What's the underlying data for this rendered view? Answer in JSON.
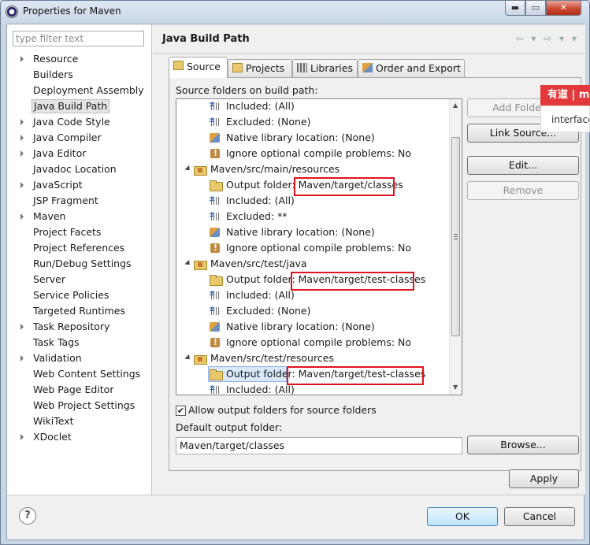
{
  "window": {
    "title": "Properties for Maven",
    "controls": {
      "minimize": "▬",
      "maximize": "▭",
      "close": "✕"
    }
  },
  "sidebar": {
    "filter_placeholder": "type filter text",
    "items": [
      {
        "label": "Resource",
        "expandable": true
      },
      {
        "label": "Builders",
        "expandable": false
      },
      {
        "label": "Deployment Assembly",
        "expandable": false
      },
      {
        "label": "Java Build Path",
        "expandable": false,
        "selected": true
      },
      {
        "label": "Java Code Style",
        "expandable": true
      },
      {
        "label": "Java Compiler",
        "expandable": true
      },
      {
        "label": "Java Editor",
        "expandable": true
      },
      {
        "label": "Javadoc Location",
        "expandable": false
      },
      {
        "label": "JavaScript",
        "expandable": true
      },
      {
        "label": "JSP Fragment",
        "expandable": false
      },
      {
        "label": "Maven",
        "expandable": true
      },
      {
        "label": "Project Facets",
        "expandable": false
      },
      {
        "label": "Project References",
        "expandable": false
      },
      {
        "label": "Run/Debug Settings",
        "expandable": false
      },
      {
        "label": "Server",
        "expandable": false
      },
      {
        "label": "Service Policies",
        "expandable": false
      },
      {
        "label": "Targeted Runtimes",
        "expandable": false
      },
      {
        "label": "Task Repository",
        "expandable": true
      },
      {
        "label": "Task Tags",
        "expandable": false
      },
      {
        "label": "Validation",
        "expandable": true
      },
      {
        "label": "Web Content Settings",
        "expandable": false
      },
      {
        "label": "Web Page Editor",
        "expandable": false
      },
      {
        "label": "Web Project Settings",
        "expandable": false
      },
      {
        "label": "WikiText",
        "expandable": false
      },
      {
        "label": "XDoclet",
        "expandable": true
      }
    ]
  },
  "page": {
    "title": "Java Build Path",
    "nav_icons": "⇦ ▾ ⇨ ▾ ▾",
    "tabs": [
      {
        "label": "Source",
        "active": true
      },
      {
        "label": "Projects",
        "active": false
      },
      {
        "label": "Libraries",
        "active": false
      },
      {
        "label": "Order and Export",
        "active": false
      }
    ],
    "source_label": "Source folders on build path:",
    "tree": [
      {
        "indent": 2,
        "icon": "filter-icon",
        "text": "Included: (All)"
      },
      {
        "indent": 2,
        "icon": "filter-icon",
        "text": "Excluded: (None)"
      },
      {
        "indent": 2,
        "icon": "library-icon",
        "text": "Native library location: (None)"
      },
      {
        "indent": 2,
        "icon": "warning-icon",
        "text": "Ignore optional compile problems: No"
      },
      {
        "indent": 1,
        "icon": "source-folder-icon",
        "text": "Maven/src/main/resources",
        "expanded": true
      },
      {
        "indent": 2,
        "icon": "folder-icon",
        "text": "Output folder: Maven/target/classes"
      },
      {
        "indent": 2,
        "icon": "filter-icon",
        "text": "Included: (All)"
      },
      {
        "indent": 2,
        "icon": "filter-icon",
        "text": "Excluded: **"
      },
      {
        "indent": 2,
        "icon": "library-icon",
        "text": "Native library location: (None)"
      },
      {
        "indent": 2,
        "icon": "warning-icon",
        "text": "Ignore optional compile problems: No"
      },
      {
        "indent": 1,
        "icon": "source-folder-icon",
        "text": "Maven/src/test/java",
        "expanded": true
      },
      {
        "indent": 2,
        "icon": "folder-icon",
        "text": "Output folder: Maven/target/test-classes"
      },
      {
        "indent": 2,
        "icon": "filter-icon",
        "text": "Included: (All)"
      },
      {
        "indent": 2,
        "icon": "filter-icon",
        "text": "Excluded: (None)"
      },
      {
        "indent": 2,
        "icon": "library-icon",
        "text": "Native library location: (None)"
      },
      {
        "indent": 2,
        "icon": "warning-icon",
        "text": "Ignore optional compile problems: No"
      },
      {
        "indent": 1,
        "icon": "source-folder-icon",
        "text": "Maven/src/test/resources",
        "expanded": true
      },
      {
        "indent": 2,
        "icon": "folder-icon",
        "text": "Output folder: Maven/target/test-classes",
        "selected": true
      },
      {
        "indent": 2,
        "icon": "filter-icon",
        "text": "Included: (All)"
      }
    ],
    "buttons": {
      "add_folder": "Add Folder...",
      "link_source": "Link Source...",
      "edit": "Edit...",
      "remove": "Remove",
      "browse": "Browse...",
      "apply": "Apply",
      "ok": "OK",
      "cancel": "Cancel"
    },
    "allow_output_label": "Allow output folders for source folders",
    "allow_output_checked": true,
    "default_output_label": "Default output folder:",
    "default_output_value": "Maven/target/classes"
  },
  "youdao": {
    "logo": "有道",
    "top_suffix": "m",
    "word": "interface"
  },
  "help_glyph": "?",
  "colors": {
    "highlight_box": "#e0141e",
    "youdao_red": "#e4393c",
    "selection": "#d9e8fb"
  }
}
